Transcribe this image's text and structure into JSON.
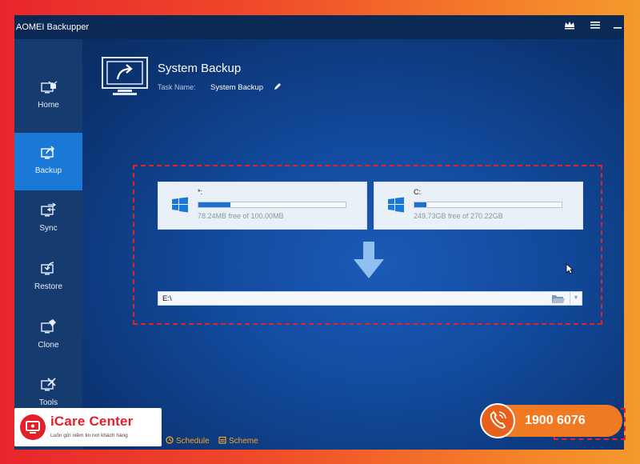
{
  "window": {
    "title": "AOMEI Backupper",
    "titlebar_icons": [
      "crown-icon",
      "menu-icon",
      "minimize-icon"
    ]
  },
  "sidebar": {
    "items": [
      {
        "label": "Home",
        "icon": "home-icon",
        "active": false
      },
      {
        "label": "Backup",
        "icon": "backup-icon",
        "active": true
      },
      {
        "label": "Sync",
        "icon": "sync-icon",
        "active": false
      },
      {
        "label": "Restore",
        "icon": "restore-icon",
        "active": false
      },
      {
        "label": "Clone",
        "icon": "clone-icon",
        "active": false
      },
      {
        "label": "Tools",
        "icon": "tools-icon",
        "active": false
      }
    ]
  },
  "main": {
    "title": "System Backup",
    "task_name_label": "Task Name:",
    "task_name_value": "System Backup",
    "source_disks": [
      {
        "name": "*:",
        "free_text": "78.24MB free of 100.00MB",
        "used_fraction": 0.22
      },
      {
        "name": "C:",
        "free_text": "249.73GB free of 270.22GB",
        "used_fraction": 0.08
      }
    ],
    "destination": "E:\\",
    "bottom_links": [
      {
        "label": "Schedule",
        "icon": "clock-icon"
      },
      {
        "label": "Scheme",
        "icon": "scheme-icon"
      }
    ],
    "next_button_label": "» "
  },
  "overlay": {
    "brand_name": "iCare Center",
    "brand_tagline": "Luôn gửi niềm tin nơi khách hàng",
    "phone": "1900 6076"
  },
  "colors": {
    "accent": "#1a78d6",
    "sidebar": "#163b6e",
    "highlight_border": "#e0242c",
    "brand_red": "#e3202a",
    "phone_orange": "#f07a24"
  }
}
